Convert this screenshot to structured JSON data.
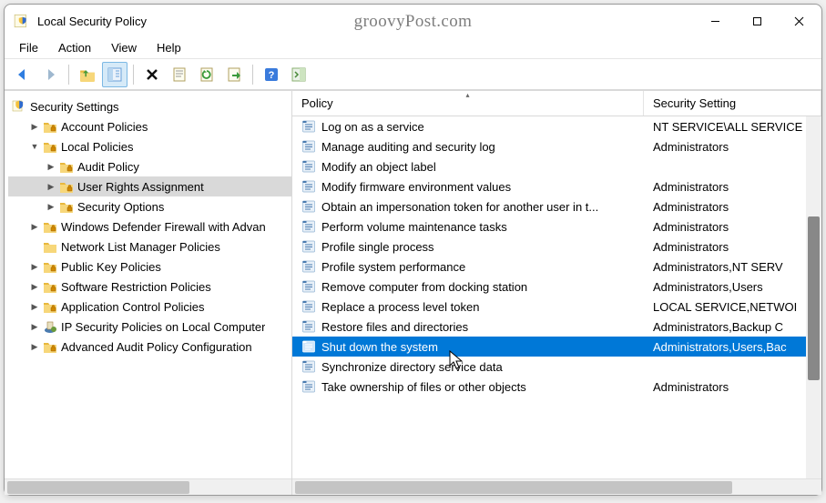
{
  "window": {
    "title": "Local Security Policy",
    "watermark": "groovyPost.com"
  },
  "menu": [
    "File",
    "Action",
    "View",
    "Help"
  ],
  "tree": {
    "root": "Security Settings",
    "items": [
      {
        "label": "Account Policies",
        "indent": 1,
        "twisty": "right"
      },
      {
        "label": "Local Policies",
        "indent": 1,
        "twisty": "down"
      },
      {
        "label": "Audit Policy",
        "indent": 2,
        "twisty": "right"
      },
      {
        "label": "User Rights Assignment",
        "indent": 2,
        "twisty": "right",
        "selected": true
      },
      {
        "label": "Security Options",
        "indent": 2,
        "twisty": "right"
      },
      {
        "label": "Windows Defender Firewall with Advan",
        "indent": 1,
        "twisty": "right"
      },
      {
        "label": "Network List Manager Policies",
        "indent": 1,
        "twisty": "none",
        "plain": true
      },
      {
        "label": "Public Key Policies",
        "indent": 1,
        "twisty": "right"
      },
      {
        "label": "Software Restriction Policies",
        "indent": 1,
        "twisty": "right"
      },
      {
        "label": "Application Control Policies",
        "indent": 1,
        "twisty": "right"
      },
      {
        "label": "IP Security Policies on Local Computer",
        "indent": 1,
        "twisty": "right",
        "ipsec": true
      },
      {
        "label": "Advanced Audit Policy Configuration",
        "indent": 1,
        "twisty": "right"
      }
    ]
  },
  "columns": {
    "policy": "Policy",
    "setting": "Security Setting"
  },
  "rows": [
    {
      "policy": "Log on as a service",
      "setting": "NT SERVICE\\ALL SERVICE"
    },
    {
      "policy": "Manage auditing and security log",
      "setting": "Administrators"
    },
    {
      "policy": "Modify an object label",
      "setting": ""
    },
    {
      "policy": "Modify firmware environment values",
      "setting": "Administrators"
    },
    {
      "policy": "Obtain an impersonation token for another user in t...",
      "setting": "Administrators"
    },
    {
      "policy": "Perform volume maintenance tasks",
      "setting": "Administrators"
    },
    {
      "policy": "Profile single process",
      "setting": "Administrators"
    },
    {
      "policy": "Profile system performance",
      "setting": "Administrators,NT SERV"
    },
    {
      "policy": "Remove computer from docking station",
      "setting": "Administrators,Users"
    },
    {
      "policy": "Replace a process level token",
      "setting": "LOCAL SERVICE,NETWOI"
    },
    {
      "policy": "Restore files and directories",
      "setting": "Administrators,Backup C"
    },
    {
      "policy": "Shut down the system",
      "setting": "Administrators,Users,Bac",
      "selected": true
    },
    {
      "policy": "Synchronize directory service data",
      "setting": ""
    },
    {
      "policy": "Take ownership of files or other objects",
      "setting": "Administrators"
    }
  ]
}
